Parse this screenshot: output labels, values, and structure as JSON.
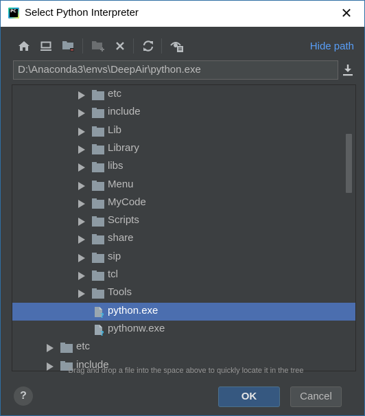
{
  "window": {
    "title": "Select Python Interpreter",
    "app_icon": "pycharm-icon",
    "close_icon": "close-icon"
  },
  "toolbar": {
    "buttons": [
      {
        "name": "home",
        "icon": "home-icon",
        "enabled": true
      },
      {
        "name": "desktop",
        "icon": "desktop-icon",
        "enabled": true
      },
      {
        "name": "project",
        "icon": "project-folder-icon",
        "enabled": true
      },
      {
        "name": "new-folder",
        "icon": "new-folder-icon",
        "enabled": false
      },
      {
        "name": "delete",
        "icon": "delete-icon",
        "enabled": true
      },
      {
        "name": "refresh",
        "icon": "refresh-icon",
        "enabled": true
      },
      {
        "name": "show-hidden",
        "icon": "show-hidden-icon",
        "enabled": true
      }
    ],
    "hide_path_label": "Hide path"
  },
  "path_field": {
    "value": "D:\\Anaconda3\\envs\\DeepAir\\python.exe"
  },
  "tree": {
    "items": [
      {
        "label": "etc",
        "type": "folder",
        "depth": 2
      },
      {
        "label": "include",
        "type": "folder",
        "depth": 2
      },
      {
        "label": "Lib",
        "type": "folder",
        "depth": 2
      },
      {
        "label": "Library",
        "type": "folder",
        "depth": 2
      },
      {
        "label": "libs",
        "type": "folder",
        "depth": 2
      },
      {
        "label": "Menu",
        "type": "folder",
        "depth": 2
      },
      {
        "label": "MyCode",
        "type": "folder",
        "depth": 2
      },
      {
        "label": "Scripts",
        "type": "folder",
        "depth": 2
      },
      {
        "label": "share",
        "type": "folder",
        "depth": 2
      },
      {
        "label": "sip",
        "type": "folder",
        "depth": 2
      },
      {
        "label": "tcl",
        "type": "folder",
        "depth": 2
      },
      {
        "label": "Tools",
        "type": "folder",
        "depth": 2
      },
      {
        "label": "python.exe",
        "type": "file",
        "depth": 2,
        "selected": true
      },
      {
        "label": "pythonw.exe",
        "type": "file",
        "depth": 2
      },
      {
        "label": "etc",
        "type": "folder",
        "depth": 1
      },
      {
        "label": "include",
        "type": "folder",
        "depth": 1
      }
    ]
  },
  "hint": "Drag and drop a file into the space above to quickly locate it in the tree",
  "buttons": {
    "help": "?",
    "ok": "OK",
    "cancel": "Cancel"
  }
}
